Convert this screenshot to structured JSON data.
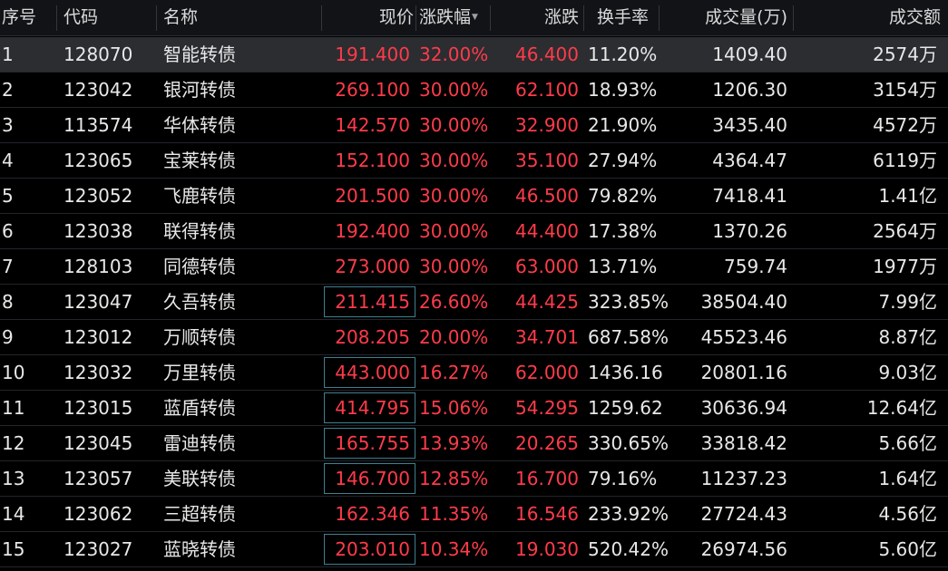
{
  "headers": {
    "idx": "序号",
    "code": "代码",
    "name": "名称",
    "price": "现价",
    "pct": "涨跌幅",
    "chg": "涨跌",
    "turnover": "换手率",
    "volume": "成交量(万)",
    "amount": "成交额"
  },
  "rows": [
    {
      "idx": "1",
      "code": "128070",
      "name": "智能转债",
      "price": "191.400",
      "pct": "32.00%",
      "chg": "46.400",
      "turnover": "11.20%",
      "volume": "1409.40",
      "amount": "2574万",
      "boxed": false
    },
    {
      "idx": "2",
      "code": "123042",
      "name": "银河转债",
      "price": "269.100",
      "pct": "30.00%",
      "chg": "62.100",
      "turnover": "18.93%",
      "volume": "1206.30",
      "amount": "3154万",
      "boxed": false
    },
    {
      "idx": "3",
      "code": "113574",
      "name": "华体转债",
      "price": "142.570",
      "pct": "30.00%",
      "chg": "32.900",
      "turnover": "21.90%",
      "volume": "3435.40",
      "amount": "4572万",
      "boxed": false
    },
    {
      "idx": "4",
      "code": "123065",
      "name": "宝莱转债",
      "price": "152.100",
      "pct": "30.00%",
      "chg": "35.100",
      "turnover": "27.94%",
      "volume": "4364.47",
      "amount": "6119万",
      "boxed": false
    },
    {
      "idx": "5",
      "code": "123052",
      "name": "飞鹿转债",
      "price": "201.500",
      "pct": "30.00%",
      "chg": "46.500",
      "turnover": "79.82%",
      "volume": "7418.41",
      "amount": "1.41亿",
      "boxed": false
    },
    {
      "idx": "6",
      "code": "123038",
      "name": "联得转债",
      "price": "192.400",
      "pct": "30.00%",
      "chg": "44.400",
      "turnover": "17.38%",
      "volume": "1370.26",
      "amount": "2564万",
      "boxed": false
    },
    {
      "idx": "7",
      "code": "128103",
      "name": "同德转债",
      "price": "273.000",
      "pct": "30.00%",
      "chg": "63.000",
      "turnover": "13.71%",
      "volume": "759.74",
      "amount": "1977万",
      "boxed": false
    },
    {
      "idx": "8",
      "code": "123047",
      "name": "久吾转债",
      "price": "211.415",
      "pct": "26.60%",
      "chg": "44.425",
      "turnover": "323.85%",
      "volume": "38504.40",
      "amount": "7.99亿",
      "boxed": true
    },
    {
      "idx": "9",
      "code": "123012",
      "name": "万顺转债",
      "price": "208.205",
      "pct": "20.00%",
      "chg": "34.701",
      "turnover": "687.58%",
      "volume": "45523.46",
      "amount": "8.87亿",
      "boxed": false
    },
    {
      "idx": "10",
      "code": "123032",
      "name": "万里转债",
      "price": "443.000",
      "pct": "16.27%",
      "chg": "62.000",
      "turnover": "1436.16",
      "volume": "20801.16",
      "amount": "9.03亿",
      "boxed": true
    },
    {
      "idx": "11",
      "code": "123015",
      "name": "蓝盾转债",
      "price": "414.795",
      "pct": "15.06%",
      "chg": "54.295",
      "turnover": "1259.62",
      "volume": "30636.94",
      "amount": "12.64亿",
      "boxed": true
    },
    {
      "idx": "12",
      "code": "123045",
      "name": "雷迪转债",
      "price": "165.755",
      "pct": "13.93%",
      "chg": "20.265",
      "turnover": "330.65%",
      "volume": "33818.42",
      "amount": "5.66亿",
      "boxed": true
    },
    {
      "idx": "13",
      "code": "123057",
      "name": "美联转债",
      "price": "146.700",
      "pct": "12.85%",
      "chg": "16.700",
      "turnover": "79.16%",
      "volume": "11237.23",
      "amount": "1.64亿",
      "boxed": true
    },
    {
      "idx": "14",
      "code": "123062",
      "name": "三超转债",
      "price": "162.346",
      "pct": "11.35%",
      "chg": "16.546",
      "turnover": "233.92%",
      "volume": "27724.43",
      "amount": "4.56亿",
      "boxed": false
    },
    {
      "idx": "15",
      "code": "123027",
      "name": "蓝晓转债",
      "price": "203.010",
      "pct": "10.34%",
      "chg": "19.030",
      "turnover": "520.42%",
      "volume": "26974.56",
      "amount": "5.60亿",
      "boxed": true
    }
  ],
  "selected_row": 0,
  "sort_column": "pct",
  "sort_icon": "sort-desc-icon",
  "colors": {
    "up": "#ff3b4a",
    "neutral": "#e8e8e8",
    "background": "#000000",
    "box": "#3f7f8f"
  }
}
